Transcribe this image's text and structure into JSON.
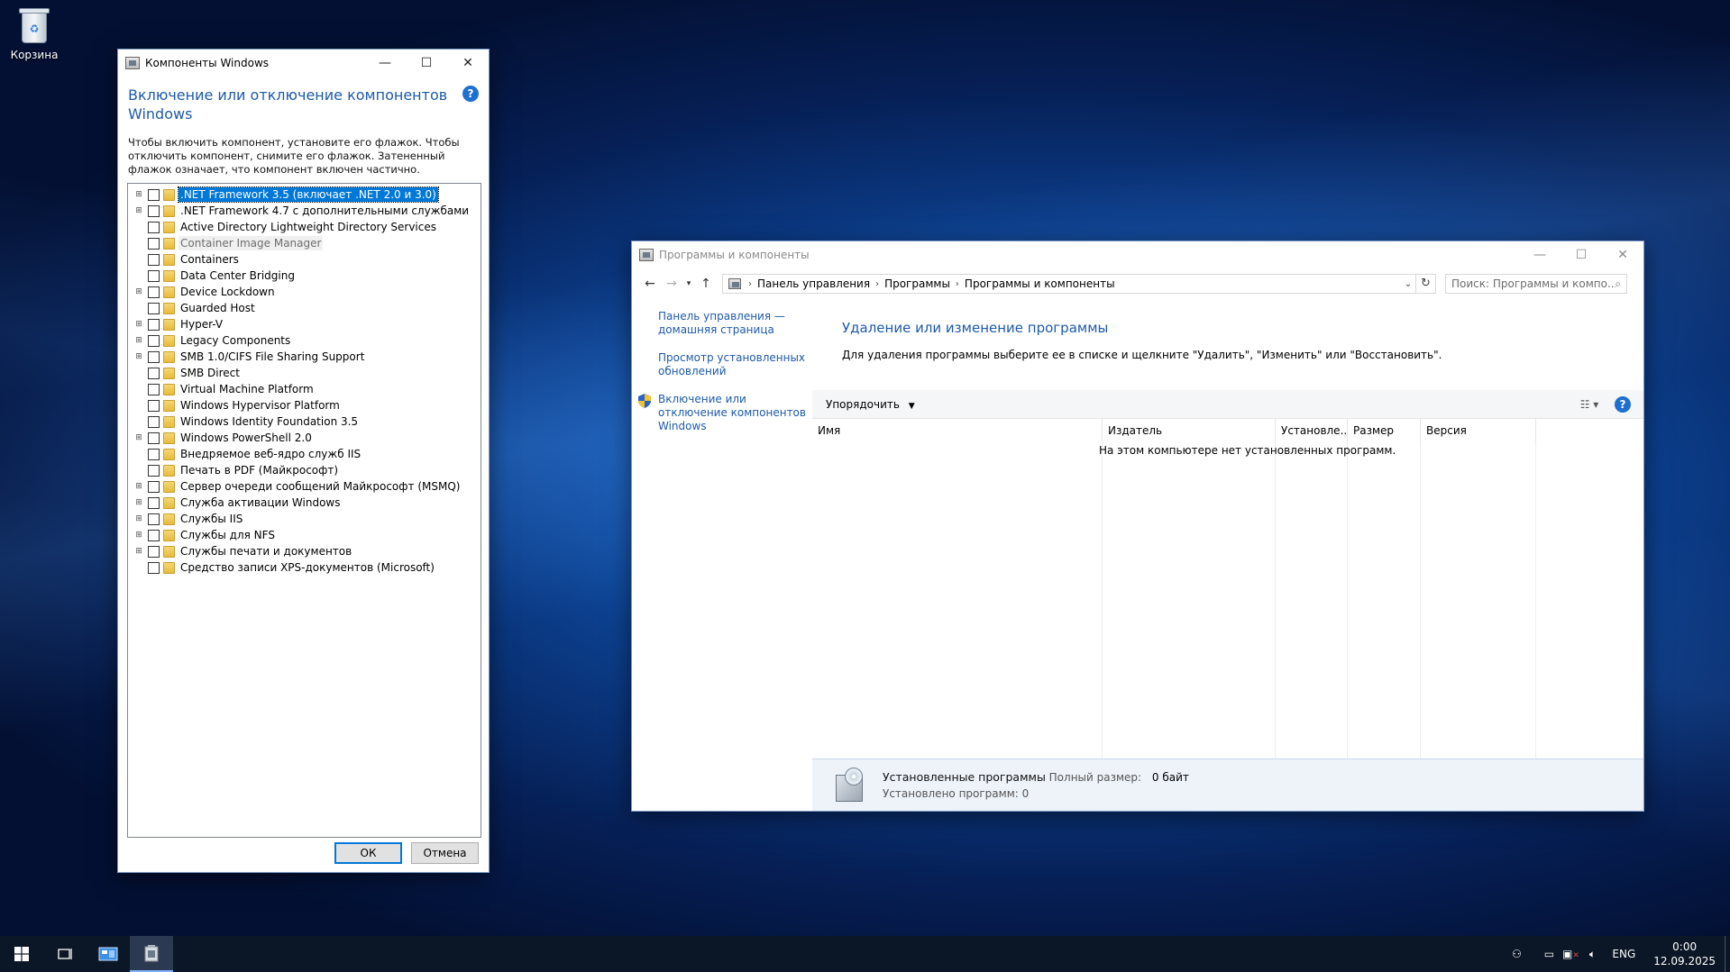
{
  "desktop": {
    "recycle_bin_label": "Корзина"
  },
  "features_dialog": {
    "title": "Компоненты Windows",
    "heading": "Включение или отключение компонентов Windows",
    "description": "Чтобы включить компонент, установите его флажок. Чтобы отключить компонент, снимите его флажок. Затененный флажок означает, что компонент включен частично.",
    "items": [
      {
        "label": ".NET Framework 3.5 (включает .NET 2.0 и 3.0)",
        "expandable": true,
        "selected": true,
        "disabled": false
      },
      {
        "label": ".NET Framework 4.7 с дополнительными службами",
        "expandable": true,
        "selected": false,
        "disabled": false
      },
      {
        "label": "Active Directory Lightweight Directory Services",
        "expandable": false,
        "selected": false,
        "disabled": false
      },
      {
        "label": "Container Image Manager",
        "expandable": false,
        "selected": false,
        "disabled": true
      },
      {
        "label": "Containers",
        "expandable": false,
        "selected": false,
        "disabled": false
      },
      {
        "label": "Data Center Bridging",
        "expandable": false,
        "selected": false,
        "disabled": false
      },
      {
        "label": "Device Lockdown",
        "expandable": true,
        "selected": false,
        "disabled": false
      },
      {
        "label": "Guarded Host",
        "expandable": false,
        "selected": false,
        "disabled": false
      },
      {
        "label": "Hyper-V",
        "expandable": true,
        "selected": false,
        "disabled": false
      },
      {
        "label": "Legacy Components",
        "expandable": true,
        "selected": false,
        "disabled": false
      },
      {
        "label": "SMB 1.0/CIFS File Sharing Support",
        "expandable": true,
        "selected": false,
        "disabled": false
      },
      {
        "label": "SMB Direct",
        "expandable": false,
        "selected": false,
        "disabled": false
      },
      {
        "label": "Virtual Machine Platform",
        "expandable": false,
        "selected": false,
        "disabled": false
      },
      {
        "label": "Windows Hypervisor Platform",
        "expandable": false,
        "selected": false,
        "disabled": false
      },
      {
        "label": "Windows Identity Foundation 3.5",
        "expandable": false,
        "selected": false,
        "disabled": false
      },
      {
        "label": "Windows PowerShell 2.0",
        "expandable": true,
        "selected": false,
        "disabled": false
      },
      {
        "label": "Внедряемое веб-ядро служб IIS",
        "expandable": false,
        "selected": false,
        "disabled": false
      },
      {
        "label": "Печать в PDF (Майкрософт)",
        "expandable": false,
        "selected": false,
        "disabled": false
      },
      {
        "label": "Сервер очереди сообщений Майкрософт (MSMQ)",
        "expandable": true,
        "selected": false,
        "disabled": false
      },
      {
        "label": "Служба активации Windows",
        "expandable": true,
        "selected": false,
        "disabled": false
      },
      {
        "label": "Службы IIS",
        "expandable": true,
        "selected": false,
        "disabled": false
      },
      {
        "label": "Службы для NFS",
        "expandable": true,
        "selected": false,
        "disabled": false
      },
      {
        "label": "Службы печати и документов",
        "expandable": true,
        "selected": false,
        "disabled": false
      },
      {
        "label": "Средство записи XPS-документов (Microsoft)",
        "expandable": false,
        "selected": false,
        "disabled": false
      }
    ],
    "ok_label": "ОК",
    "cancel_label": "Отмена"
  },
  "programs_window": {
    "title": "Программы и компоненты",
    "breadcrumb": [
      "Панель управления",
      "Программы",
      "Программы и компоненты"
    ],
    "search_placeholder": "Поиск: Программы и компо...",
    "left_links": [
      "Панель управления — домашняя страница",
      "Просмотр установленных обновлений",
      "Включение или отключение компонентов Windows"
    ],
    "heading": "Удаление или изменение программы",
    "subtext": "Для удаления программы выберите ее в списке и щелкните \"Удалить\", \"Изменить\" или \"Восстановить\".",
    "organize_label": "Упорядочить",
    "columns": [
      "Имя",
      "Издатель",
      "Установле...",
      "Размер",
      "Версия"
    ],
    "empty_message": "На этом компьютере нет установленных программ.",
    "status": {
      "title": "Установленные программы",
      "size_label": "Полный размер:",
      "size_value": "0 байт",
      "count_text": "Установлено программ: 0"
    }
  },
  "taskbar": {
    "language": "ENG",
    "time": "0:00",
    "date": "12.09.2025"
  },
  "colors": {
    "accent": "#0078d7",
    "link": "#1e5aa8",
    "taskbar": "#0b1626"
  }
}
